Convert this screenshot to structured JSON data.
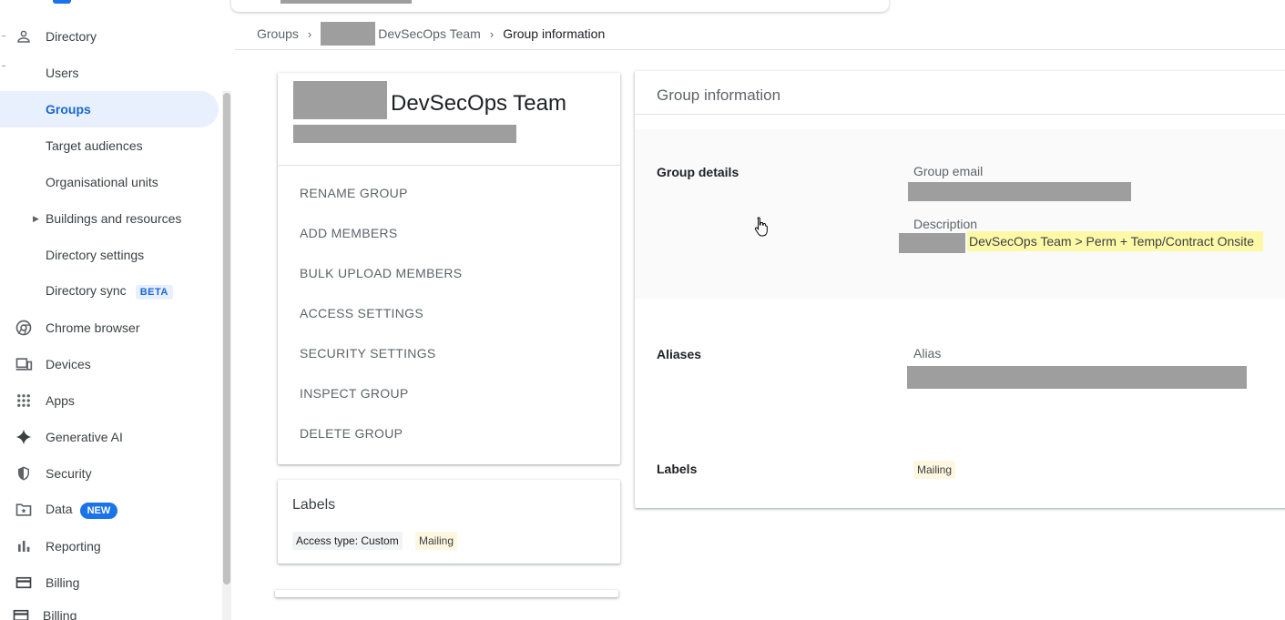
{
  "sidebar": {
    "items": [
      {
        "label": "Directory",
        "icon": "person-icon"
      },
      {
        "label": "Users"
      },
      {
        "label": "Groups"
      },
      {
        "label": "Target audiences"
      },
      {
        "label": "Organisational units"
      },
      {
        "label": "Buildings and resources"
      },
      {
        "label": "Directory settings"
      },
      {
        "label": "Directory sync",
        "badge": "BETA"
      },
      {
        "label": "Chrome browser",
        "icon": "chrome-icon"
      },
      {
        "label": "Devices",
        "icon": "devices-icon"
      },
      {
        "label": "Apps",
        "icon": "apps-grid-icon"
      },
      {
        "label": "Generative AI",
        "icon": "sparkle-icon"
      },
      {
        "label": "Security",
        "icon": "shield-icon"
      },
      {
        "label": "Data",
        "icon": "data-folder-icon",
        "badge": "NEW"
      },
      {
        "label": "Reporting",
        "icon": "bar-chart-icon"
      },
      {
        "label": "Billing",
        "icon": "billing-card-icon"
      },
      {
        "label": "Billing",
        "icon": "billing-card-icon"
      }
    ]
  },
  "breadcrumb": {
    "root": "Groups",
    "group": "DevSecOps Team",
    "current": "Group information"
  },
  "group_card": {
    "name": "DevSecOps Team",
    "actions": [
      "RENAME GROUP",
      "ADD MEMBERS",
      "BULK UPLOAD MEMBERS",
      "ACCESS SETTINGS",
      "SECURITY SETTINGS",
      "INSPECT GROUP",
      "DELETE GROUP"
    ]
  },
  "labels_card": {
    "title": "Labels",
    "chips": [
      "Access type: Custom",
      "Mailing"
    ]
  },
  "info_panel": {
    "title": "Group information",
    "group_details_label": "Group details",
    "group_email_label": "Group email",
    "description_label": "Description",
    "description_text": "DevSecOps Team > Perm + Temp/Contract Onsite",
    "aliases_label": "Aliases",
    "alias_label": "Alias",
    "labels_label": "Labels",
    "label_chip": "Mailing"
  },
  "colors": {
    "accent": "#1a73e8",
    "active_nav_bg": "#e8f0fe",
    "highlight": "#fef9a7",
    "redaction": "#9e9e9e"
  }
}
